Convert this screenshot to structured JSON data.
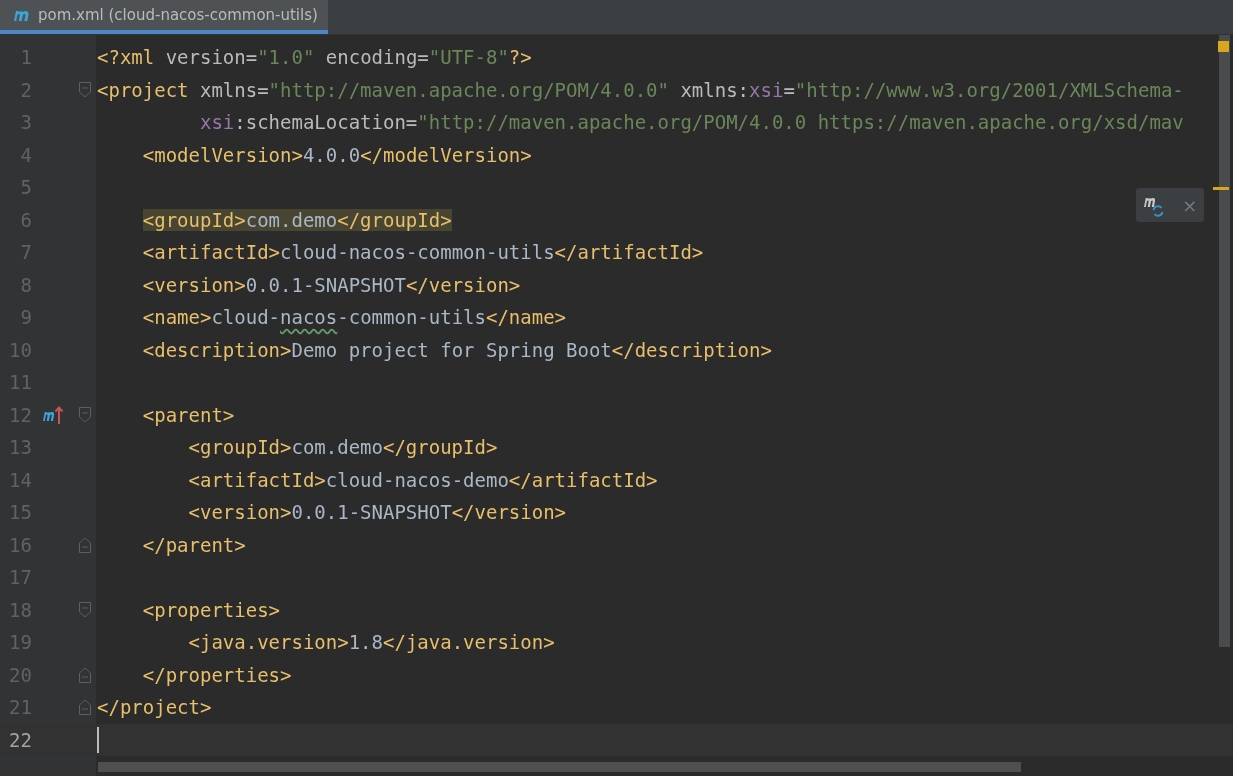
{
  "tab": {
    "title": "pom.xml (cloud-nacos-common-utils)",
    "selected": true
  },
  "popup": {
    "close": "×"
  },
  "lines": [
    {
      "number": "1",
      "current": false,
      "fold_start": false,
      "fold_end": false,
      "overrides": false,
      "segments": [
        {
          "kind": "tag",
          "text": "<?xml "
        },
        {
          "kind": "attr",
          "text": "version="
        },
        {
          "kind": "value",
          "text": "\"1.0\""
        },
        {
          "kind": "attr",
          "text": " encoding="
        },
        {
          "kind": "value",
          "text": "\"UTF-8\""
        },
        {
          "kind": "tag",
          "text": "?>"
        }
      ]
    },
    {
      "number": "2",
      "current": false,
      "fold_start": true,
      "fold_end": false,
      "overrides": false,
      "segments": [
        {
          "kind": "tag",
          "text": "<project "
        },
        {
          "kind": "attr",
          "text": "xmlns="
        },
        {
          "kind": "value",
          "text": "\"http://maven.apache.org/POM/4.0.0\""
        },
        {
          "kind": "attr",
          "text": " xmlns:"
        },
        {
          "kind": "ns",
          "text": "xsi"
        },
        {
          "kind": "attr",
          "text": "="
        },
        {
          "kind": "value",
          "text": "\"http://www.w3.org/2001/XMLSchema-"
        }
      ]
    },
    {
      "number": "3",
      "current": false,
      "fold_start": false,
      "fold_end": false,
      "overrides": false,
      "segments": [
        {
          "kind": "ns",
          "text": "         xsi"
        },
        {
          "kind": "attr",
          "text": ":schemaLocation="
        },
        {
          "kind": "value",
          "text": "\"http://maven.apache.org/POM/4.0.0 https://maven.apache.org/xsd/mav"
        }
      ]
    },
    {
      "number": "4",
      "current": false,
      "fold_start": false,
      "fold_end": false,
      "overrides": false,
      "segments": [
        {
          "kind": "tag",
          "text": "    <modelVersion>"
        },
        {
          "kind": "text",
          "text": "4.0.0"
        },
        {
          "kind": "tag",
          "text": "</modelVersion>"
        }
      ]
    },
    {
      "number": "5",
      "current": false,
      "fold_start": false,
      "fold_end": false,
      "overrides": false
    },
    {
      "number": "6",
      "current": false,
      "fold_start": false,
      "fold_end": false,
      "overrides": false,
      "segments": [
        {
          "kind": "tag",
          "text": "    <groupId>",
          "highlighted": true
        },
        {
          "kind": "text",
          "text": "com.demo",
          "highlighted": true
        },
        {
          "kind": "tag",
          "text": "</groupId>",
          "highlighted": true
        }
      ]
    },
    {
      "number": "7",
      "current": false,
      "fold_start": false,
      "fold_end": false,
      "overrides": false,
      "segments": [
        {
          "kind": "tag",
          "text": "    <artifactId>"
        },
        {
          "kind": "text",
          "text": "cloud-nacos-common-utils"
        },
        {
          "kind": "tag",
          "text": "</artifactId>"
        }
      ]
    },
    {
      "number": "8",
      "current": false,
      "fold_start": false,
      "fold_end": false,
      "overrides": false,
      "segments": [
        {
          "kind": "tag",
          "text": "    <version>"
        },
        {
          "kind": "text",
          "text": "0.0.1-SNAPSHOT"
        },
        {
          "kind": "tag",
          "text": "</version>"
        }
      ]
    },
    {
      "number": "9",
      "current": false,
      "fold_start": false,
      "fold_end": false,
      "overrides": false,
      "segments": [
        {
          "kind": "tag",
          "text": "    <name>"
        },
        {
          "kind": "text",
          "text": "cloud-"
        },
        {
          "kind": "text",
          "text": "nacos",
          "typo": true
        },
        {
          "kind": "text",
          "text": "-common-utils"
        },
        {
          "kind": "tag",
          "text": "</name>"
        }
      ]
    },
    {
      "number": "10",
      "current": false,
      "fold_start": false,
      "fold_end": false,
      "overrides": false,
      "segments": [
        {
          "kind": "tag",
          "text": "    <description>"
        },
        {
          "kind": "text",
          "text": "Demo project for Spring Boot"
        },
        {
          "kind": "tag",
          "text": "</description>"
        }
      ]
    },
    {
      "number": "11",
      "current": false,
      "fold_start": false,
      "fold_end": false,
      "overrides": false
    },
    {
      "number": "12",
      "current": false,
      "fold_start": true,
      "fold_end": false,
      "overrides": true,
      "segments": [
        {
          "kind": "tag",
          "text": "    <parent>"
        }
      ]
    },
    {
      "number": "13",
      "current": false,
      "fold_start": false,
      "fold_end": false,
      "overrides": false,
      "segments": [
        {
          "kind": "tag",
          "text": "        <groupId>"
        },
        {
          "kind": "text",
          "text": "com.demo"
        },
        {
          "kind": "tag",
          "text": "</groupId>"
        }
      ]
    },
    {
      "number": "14",
      "current": false,
      "fold_start": false,
      "fold_end": false,
      "overrides": false,
      "segments": [
        {
          "kind": "tag",
          "text": "        <artifactId>"
        },
        {
          "kind": "text",
          "text": "cloud-nacos-demo"
        },
        {
          "kind": "tag",
          "text": "</artifactId>"
        }
      ]
    },
    {
      "number": "15",
      "current": false,
      "fold_start": false,
      "fold_end": false,
      "overrides": false,
      "segments": [
        {
          "kind": "tag",
          "text": "        <version>"
        },
        {
          "kind": "text",
          "text": "0.0.1-SNAPSHOT"
        },
        {
          "kind": "tag",
          "text": "</version>"
        }
      ]
    },
    {
      "number": "16",
      "current": false,
      "fold_start": false,
      "fold_end": true,
      "overrides": false,
      "segments": [
        {
          "kind": "tag",
          "text": "    </parent>"
        }
      ]
    },
    {
      "number": "17",
      "current": false,
      "fold_start": false,
      "fold_end": false,
      "overrides": false
    },
    {
      "number": "18",
      "current": false,
      "fold_start": true,
      "fold_end": false,
      "overrides": false,
      "segments": [
        {
          "kind": "tag",
          "text": "    <properties>"
        }
      ]
    },
    {
      "number": "19",
      "current": false,
      "fold_start": false,
      "fold_end": false,
      "overrides": false,
      "segments": [
        {
          "kind": "tag",
          "text": "        <java.version>"
        },
        {
          "kind": "text",
          "text": "1.8"
        },
        {
          "kind": "tag",
          "text": "</java.version>"
        }
      ]
    },
    {
      "number": "20",
      "current": false,
      "fold_start": false,
      "fold_end": true,
      "overrides": false,
      "segments": [
        {
          "kind": "tag",
          "text": "    </properties>"
        }
      ]
    },
    {
      "number": "21",
      "current": false,
      "fold_start": false,
      "fold_end": true,
      "overrides": false,
      "segments": [
        {
          "kind": "tag",
          "text": "</project>"
        }
      ]
    },
    {
      "number": "22",
      "current": true,
      "fold_start": false,
      "fold_end": false,
      "overrides": false
    }
  ]
}
